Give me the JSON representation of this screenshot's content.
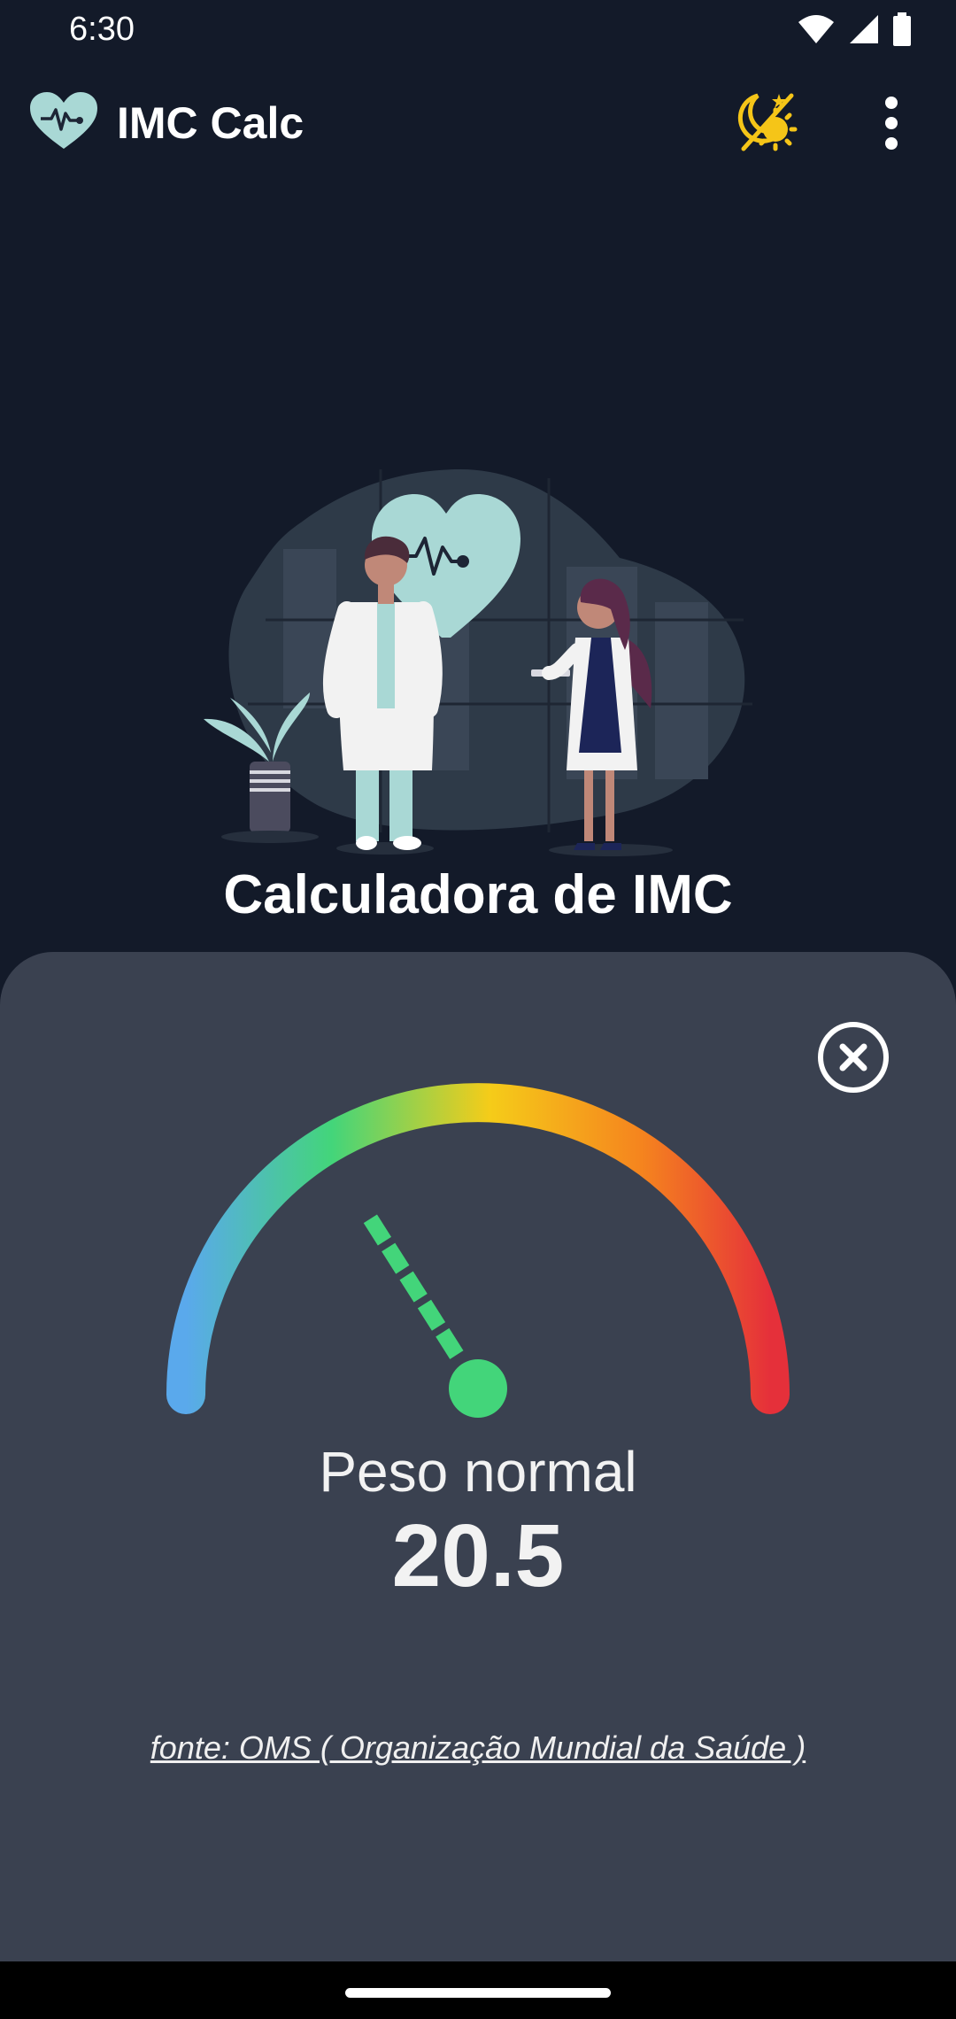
{
  "status_bar": {
    "time": "6:30",
    "icons": [
      "wifi-icon",
      "signal-icon",
      "battery-icon"
    ]
  },
  "app_bar": {
    "title": "IMC Calc",
    "actions": [
      "theme-toggle-icon",
      "more-vert-icon"
    ]
  },
  "hero": {
    "title": "Calculadora de IMC"
  },
  "result": {
    "category": "Peso normal",
    "value": "20.5",
    "gauge_level": 0.32,
    "source": "fonte: OMS ( Organização Mundial da Saúde )"
  },
  "colors": {
    "background": "#131a29",
    "sheet": "#3a4150",
    "accent_teal": "#a9d8d5",
    "toggle_yellow": "#f5c518",
    "gauge_blue": "#5aa9ec",
    "gauge_green": "#43d57a",
    "gauge_yellow": "#f5cc19",
    "gauge_orange": "#f5841e",
    "gauge_red": "#e5303a"
  }
}
